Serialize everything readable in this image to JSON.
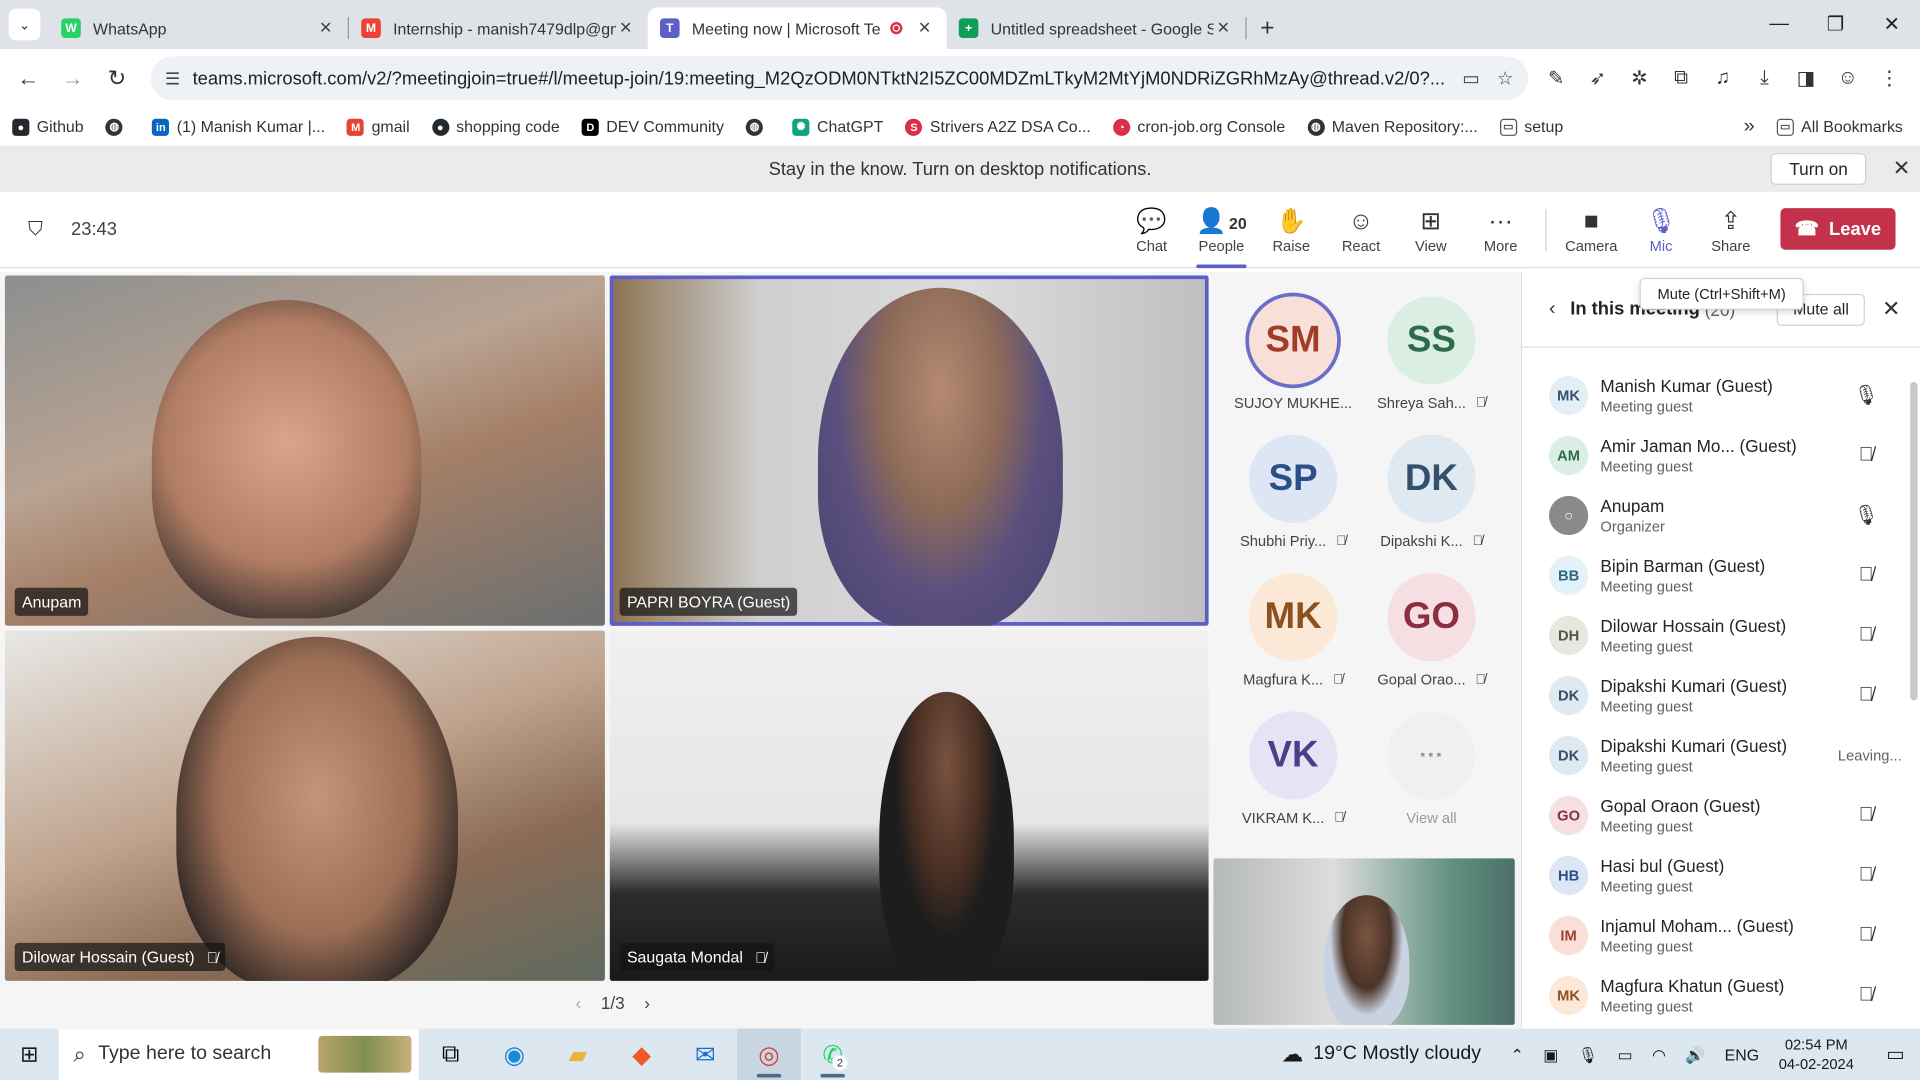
{
  "browser": {
    "tabs": [
      {
        "label": "WhatsApp",
        "color": "#25d366",
        "glyph": "W"
      },
      {
        "label": "Internship - manish7479dlp@gm",
        "color": "#ea4335",
        "glyph": "M"
      },
      {
        "label": "Meeting now | Microsoft Te",
        "color": "#5b5fc7",
        "glyph": "T",
        "active": true
      },
      {
        "label": "Untitled spreadsheet - Google S",
        "color": "#0f9d58",
        "glyph": "+"
      }
    ],
    "url": "teams.microsoft.com/v2/?meetingjoin=true#/l/meetup-join/19:meeting_M2QzODM0NTktN2I5ZC00MDZmLTkyM2MtYjM0NDRiZGRhMzAy@thread.v2/0?...",
    "bookmarks": [
      {
        "label": "Github",
        "color": "#24292e"
      },
      {
        "label": "",
        "color": "#333333"
      },
      {
        "label": "(1) Manish Kumar |...",
        "color": "#0a66c2"
      },
      {
        "label": "gmail",
        "color": "#ea4335"
      },
      {
        "label": "shopping code",
        "color": "#24292e"
      },
      {
        "label": "DEV Community",
        "color": "#000000"
      },
      {
        "label": "",
        "color": "#333333"
      },
      {
        "label": "ChatGPT",
        "color": "#10a37f"
      },
      {
        "label": "Strivers A2Z DSA Co...",
        "color": "#d9304a"
      },
      {
        "label": "cron-job.org Console",
        "color": "#d9304a"
      },
      {
        "label": "Maven Repository:...",
        "color": "#333333"
      },
      {
        "label": "setup",
        "color": "#666666"
      }
    ],
    "all_bookmarks": "All Bookmarks"
  },
  "notification": {
    "text": "Stay in the know. Turn on desktop notifications.",
    "button": "Turn on"
  },
  "meeting": {
    "timer": "23:43",
    "toolbar": {
      "chat": "Chat",
      "people": "People",
      "people_count": "20",
      "raise": "Raise",
      "react": "React",
      "view": "View",
      "more": "More",
      "camera": "Camera",
      "mic": "Mic",
      "share": "Share",
      "leave": "Leave"
    },
    "tooltip": "Mute (Ctrl+Shift+M)",
    "videos": [
      "Anupam",
      "PAPRI BOYRA (Guest)",
      "Dilowar Hossain (Guest)",
      "Saugata Mondal"
    ],
    "pager": "1/3",
    "avatars": [
      {
        "initials": "SM",
        "name": "SUJOY MUKHE...",
        "bg": "#f8e0d8",
        "fg": "#a33b2b",
        "muted": false
      },
      {
        "initials": "SS",
        "name": "Shreya Sah...",
        "bg": "#dbeee4",
        "fg": "#2e6b4a",
        "muted": true
      },
      {
        "initials": "SP",
        "name": "Shubhi Priy...",
        "bg": "#dde6f5",
        "fg": "#2c4f8a",
        "muted": true
      },
      {
        "initials": "DK",
        "name": "Dipakshi K...",
        "bg": "#dfe9f1",
        "fg": "#34506b",
        "muted": true
      },
      {
        "initials": "MK",
        "name": "Magfura K...",
        "bg": "#fbe8d6",
        "fg": "#8a5220",
        "muted": true
      },
      {
        "initials": "GO",
        "name": "Gopal Orao...",
        "bg": "#f6dfe3",
        "fg": "#8a2f3f",
        "muted": true
      },
      {
        "initials": "VK",
        "name": "VIKRAM K...",
        "bg": "#e7e3f5",
        "fg": "#4a3f8a",
        "muted": true
      },
      {
        "initials": "···",
        "name": "View all",
        "bg": "#f0f0f0",
        "fg": "#999999",
        "muted": false
      }
    ]
  },
  "panel": {
    "title": "In this meeting",
    "count": "(20)",
    "mute_all": "Mute all",
    "participants": [
      {
        "initials": "MK",
        "name": "Manish Kumar (Guest)",
        "role": "Meeting guest",
        "bg": "#e4eef5",
        "fg": "#34506b",
        "status": "mic"
      },
      {
        "initials": "AM",
        "name": "Amir Jaman Mo...   (Guest)",
        "role": "Meeting guest",
        "bg": "#dbeee4",
        "fg": "#2e6b4a",
        "status": "muted"
      },
      {
        "initials": "○",
        "name": "Anupam",
        "role": "Organizer",
        "bg": "#8a8a8a",
        "fg": "#ffffff",
        "status": "mic"
      },
      {
        "initials": "BB",
        "name": "Bipin Barman (Guest)",
        "role": "Meeting guest",
        "bg": "#e2f2f8",
        "fg": "#2a6a86",
        "status": "muted"
      },
      {
        "initials": "DH",
        "name": "Dilowar Hossain (Guest)",
        "role": "Meeting guest",
        "bg": "#e6e8e0",
        "fg": "#4f5a3a",
        "status": "muted"
      },
      {
        "initials": "DK",
        "name": "Dipakshi Kumari (Guest)",
        "role": "Meeting guest",
        "bg": "#dfe9f1",
        "fg": "#34506b",
        "status": "muted"
      },
      {
        "initials": "DK",
        "name": "Dipakshi Kumari (Guest)",
        "role": "Meeting guest",
        "bg": "#dfe9f1",
        "fg": "#34506b",
        "status": "Leaving..."
      },
      {
        "initials": "GO",
        "name": "Gopal Oraon (Guest)",
        "role": "Meeting guest",
        "bg": "#f6dfe3",
        "fg": "#8a2f3f",
        "status": "muted"
      },
      {
        "initials": "HB",
        "name": "Hasi bul (Guest)",
        "role": "Meeting guest",
        "bg": "#dde6f5",
        "fg": "#2c4f8a",
        "status": "muted"
      },
      {
        "initials": "IM",
        "name": "Injamul Moham...   (Guest)",
        "role": "Meeting guest",
        "bg": "#f8e0d8",
        "fg": "#a33b2b",
        "status": "muted"
      },
      {
        "initials": "MK",
        "name": "Magfura Khatun (Guest)",
        "role": "Meeting guest",
        "bg": "#fbe8d6",
        "fg": "#8a5220",
        "status": "muted"
      }
    ]
  },
  "taskbar": {
    "search_placeholder": "Type here to search",
    "weather": "19°C  Mostly cloudy",
    "lang": "ENG",
    "time": "02:54 PM",
    "date": "04-02-2024",
    "whatsapp_badge": "2"
  }
}
